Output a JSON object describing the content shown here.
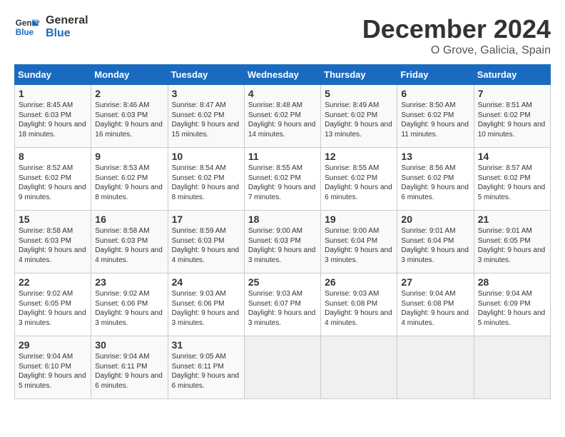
{
  "logo": {
    "line1": "General",
    "line2": "Blue"
  },
  "title": "December 2024",
  "location": "O Grove, Galicia, Spain",
  "days_of_week": [
    "Sunday",
    "Monday",
    "Tuesday",
    "Wednesday",
    "Thursday",
    "Friday",
    "Saturday"
  ],
  "weeks": [
    [
      {
        "day": "1",
        "sunrise": "8:45 AM",
        "sunset": "6:03 PM",
        "daylight": "9 hours and 18 minutes."
      },
      {
        "day": "2",
        "sunrise": "8:46 AM",
        "sunset": "6:03 PM",
        "daylight": "9 hours and 16 minutes."
      },
      {
        "day": "3",
        "sunrise": "8:47 AM",
        "sunset": "6:02 PM",
        "daylight": "9 hours and 15 minutes."
      },
      {
        "day": "4",
        "sunrise": "8:48 AM",
        "sunset": "6:02 PM",
        "daylight": "9 hours and 14 minutes."
      },
      {
        "day": "5",
        "sunrise": "8:49 AM",
        "sunset": "6:02 PM",
        "daylight": "9 hours and 13 minutes."
      },
      {
        "day": "6",
        "sunrise": "8:50 AM",
        "sunset": "6:02 PM",
        "daylight": "9 hours and 11 minutes."
      },
      {
        "day": "7",
        "sunrise": "8:51 AM",
        "sunset": "6:02 PM",
        "daylight": "9 hours and 10 minutes."
      }
    ],
    [
      {
        "day": "8",
        "sunrise": "8:52 AM",
        "sunset": "6:02 PM",
        "daylight": "9 hours and 9 minutes."
      },
      {
        "day": "9",
        "sunrise": "8:53 AM",
        "sunset": "6:02 PM",
        "daylight": "9 hours and 8 minutes."
      },
      {
        "day": "10",
        "sunrise": "8:54 AM",
        "sunset": "6:02 PM",
        "daylight": "9 hours and 8 minutes."
      },
      {
        "day": "11",
        "sunrise": "8:55 AM",
        "sunset": "6:02 PM",
        "daylight": "9 hours and 7 minutes."
      },
      {
        "day": "12",
        "sunrise": "8:55 AM",
        "sunset": "6:02 PM",
        "daylight": "9 hours and 6 minutes."
      },
      {
        "day": "13",
        "sunrise": "8:56 AM",
        "sunset": "6:02 PM",
        "daylight": "9 hours and 6 minutes."
      },
      {
        "day": "14",
        "sunrise": "8:57 AM",
        "sunset": "6:02 PM",
        "daylight": "9 hours and 5 minutes."
      }
    ],
    [
      {
        "day": "15",
        "sunrise": "8:58 AM",
        "sunset": "6:03 PM",
        "daylight": "9 hours and 4 minutes."
      },
      {
        "day": "16",
        "sunrise": "8:58 AM",
        "sunset": "6:03 PM",
        "daylight": "9 hours and 4 minutes."
      },
      {
        "day": "17",
        "sunrise": "8:59 AM",
        "sunset": "6:03 PM",
        "daylight": "9 hours and 4 minutes."
      },
      {
        "day": "18",
        "sunrise": "9:00 AM",
        "sunset": "6:03 PM",
        "daylight": "9 hours and 3 minutes."
      },
      {
        "day": "19",
        "sunrise": "9:00 AM",
        "sunset": "6:04 PM",
        "daylight": "9 hours and 3 minutes."
      },
      {
        "day": "20",
        "sunrise": "9:01 AM",
        "sunset": "6:04 PM",
        "daylight": "9 hours and 3 minutes."
      },
      {
        "day": "21",
        "sunrise": "9:01 AM",
        "sunset": "6:05 PM",
        "daylight": "9 hours and 3 minutes."
      }
    ],
    [
      {
        "day": "22",
        "sunrise": "9:02 AM",
        "sunset": "6:05 PM",
        "daylight": "9 hours and 3 minutes."
      },
      {
        "day": "23",
        "sunrise": "9:02 AM",
        "sunset": "6:06 PM",
        "daylight": "9 hours and 3 minutes."
      },
      {
        "day": "24",
        "sunrise": "9:03 AM",
        "sunset": "6:06 PM",
        "daylight": "9 hours and 3 minutes."
      },
      {
        "day": "25",
        "sunrise": "9:03 AM",
        "sunset": "6:07 PM",
        "daylight": "9 hours and 3 minutes."
      },
      {
        "day": "26",
        "sunrise": "9:03 AM",
        "sunset": "6:08 PM",
        "daylight": "9 hours and 4 minutes."
      },
      {
        "day": "27",
        "sunrise": "9:04 AM",
        "sunset": "6:08 PM",
        "daylight": "9 hours and 4 minutes."
      },
      {
        "day": "28",
        "sunrise": "9:04 AM",
        "sunset": "6:09 PM",
        "daylight": "9 hours and 5 minutes."
      }
    ],
    [
      {
        "day": "29",
        "sunrise": "9:04 AM",
        "sunset": "6:10 PM",
        "daylight": "9 hours and 5 minutes."
      },
      {
        "day": "30",
        "sunrise": "9:04 AM",
        "sunset": "6:11 PM",
        "daylight": "9 hours and 6 minutes."
      },
      {
        "day": "31",
        "sunrise": "9:05 AM",
        "sunset": "6:11 PM",
        "daylight": "9 hours and 6 minutes."
      },
      null,
      null,
      null,
      null
    ]
  ],
  "labels": {
    "sunrise": "Sunrise:",
    "sunset": "Sunset:",
    "daylight": "Daylight:"
  }
}
